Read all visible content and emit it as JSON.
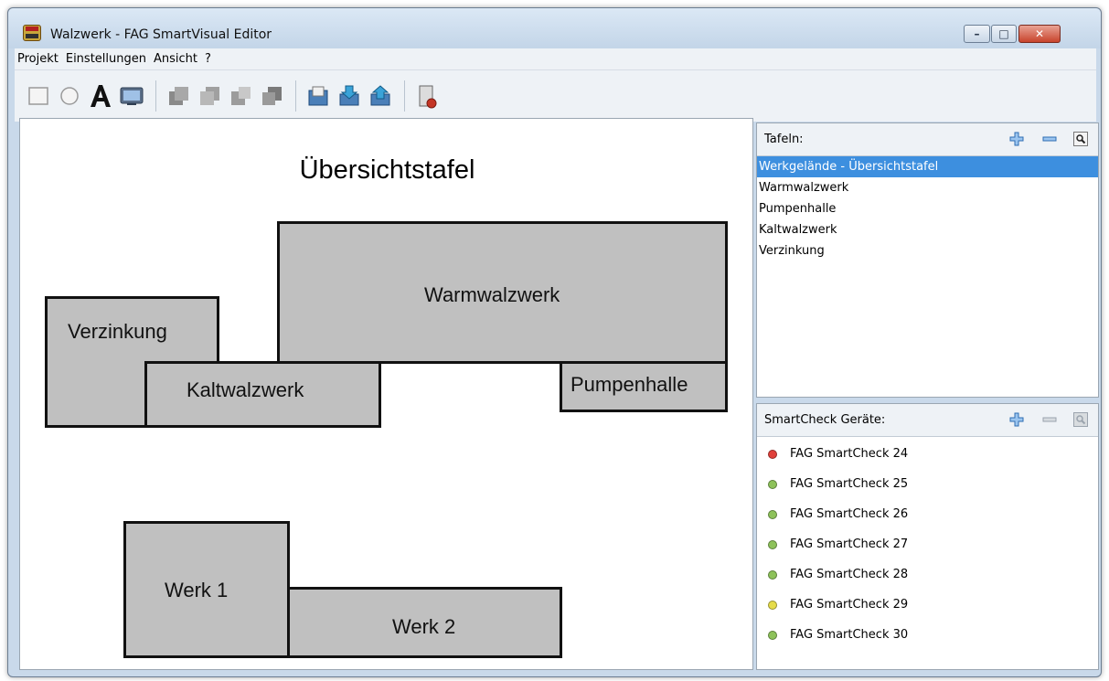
{
  "window": {
    "title": "Walzwerk - FAG SmartVisual Editor",
    "controls": {
      "minimize": "–",
      "maximize": "□",
      "close": "✕"
    }
  },
  "menu": {
    "items": [
      "Projekt",
      "Einstellungen",
      "Ansicht",
      "?"
    ]
  },
  "toolbar": {
    "icons": [
      "rectangle-icon",
      "circle-icon",
      "text-icon",
      "image-icon",
      "bring-to-front-icon",
      "bring-forward-icon",
      "send-backward-icon",
      "send-to-back-icon",
      "open-icon",
      "import-icon",
      "export-icon",
      "exit-icon"
    ]
  },
  "canvas": {
    "title": "Übersichtstafel",
    "box_color": "#c0c0c0",
    "areas": [
      "Warmwalzwerk",
      "Verzinkung",
      "Kaltwalzwerk",
      "Pumpenhalle",
      "Werk 1",
      "Werk 2"
    ]
  },
  "tafeln": {
    "label": "Tafeln:",
    "items": [
      "Werkgelände - Übersichtstafel",
      "Warmwalzwerk",
      "Pumpenhalle",
      "Kaltwalzwerk",
      "Verzinkung"
    ],
    "selected_index": 0,
    "selection_color": "#3d8fdf"
  },
  "devices": {
    "label": "SmartCheck Geräte:",
    "items": [
      {
        "name": "FAG SmartCheck 24",
        "status_color": "#e0403a"
      },
      {
        "name": "FAG SmartCheck 25",
        "status_color": "#8dc25a"
      },
      {
        "name": "FAG SmartCheck 26",
        "status_color": "#8dc25a"
      },
      {
        "name": "FAG SmartCheck 27",
        "status_color": "#8dc25a"
      },
      {
        "name": "FAG SmartCheck 28",
        "status_color": "#8dc25a"
      },
      {
        "name": "FAG SmartCheck 29",
        "status_color": "#e6dc4a"
      },
      {
        "name": "FAG SmartCheck 30",
        "status_color": "#8dc25a"
      }
    ]
  }
}
